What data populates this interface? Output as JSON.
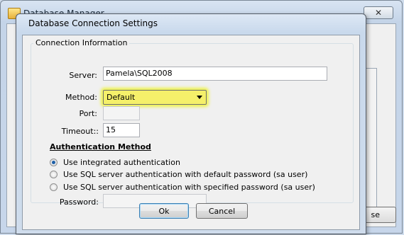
{
  "parent_window": {
    "title": "Database Manager",
    "close_glyph": "✕",
    "frag_se": "Se",
    "frag_s": "S",
    "frag_d": "D",
    "close_button_tail": "se"
  },
  "dialog": {
    "title": "Database Connection Settings",
    "group_title": "Connection Information",
    "server": {
      "label": "Server:",
      "value": "Pamela\\SQL2008"
    },
    "method": {
      "label": "Method:",
      "value": "Default",
      "highlight_color": "#f5f06a"
    },
    "port": {
      "label": "Port:",
      "value": ""
    },
    "timeout": {
      "label": "Timeout::",
      "value": "15"
    },
    "auth": {
      "heading": "Authentication Method",
      "options": [
        {
          "label": "Use integrated authentication",
          "checked": true
        },
        {
          "label": "Use SQL server authentication with default password (sa user)",
          "checked": false
        },
        {
          "label": "Use SQL server authentication with specified password (sa user)",
          "checked": false
        }
      ],
      "password": {
        "label": "Password:",
        "value": ""
      }
    },
    "buttons": {
      "ok": "Ok",
      "cancel": "Cancel"
    }
  }
}
